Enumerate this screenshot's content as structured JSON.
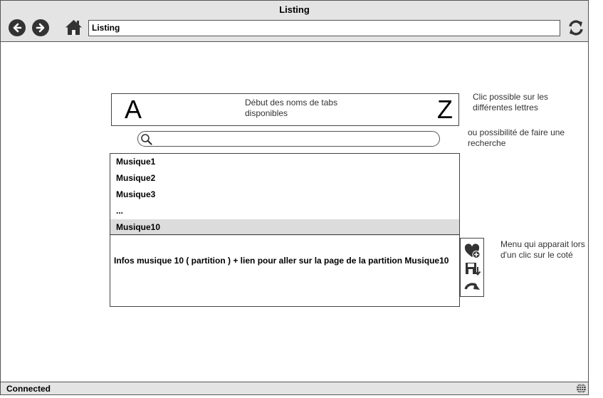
{
  "window": {
    "title": "Listing",
    "address": "Listing",
    "status": "Connected"
  },
  "toolbar": {
    "back_icon": "arrow-left-icon",
    "forward_icon": "arrow-right-icon",
    "home_icon": "home-icon",
    "refresh_icon": "refresh-icon"
  },
  "alphabet": {
    "first_letter": "A",
    "last_letter": "Z",
    "description": "Début des noms de tabs disponibles"
  },
  "notes": {
    "letters": "Clic possible sur les différentes lettres",
    "search": "ou possibilité de faire une recherche",
    "menu": "Menu qui apparait lors d'un clic sur le coté"
  },
  "search": {
    "icon": "search-icon",
    "value": ""
  },
  "list": {
    "items": [
      "Musique1",
      "Musique2",
      "Musique3",
      "...",
      "Musique10"
    ],
    "selected_index": 4,
    "detail": "Infos musique 10 ( partition ) + lien pour aller sur la page de la partition Musique10"
  },
  "side_menu": {
    "icons": [
      "heart-add-icon",
      "save-download-icon",
      "redo-arrow-icon"
    ]
  },
  "colors": {
    "chrome": "#e4e4e4",
    "selected_row": "#dcdcdc",
    "icon": "#333333"
  }
}
